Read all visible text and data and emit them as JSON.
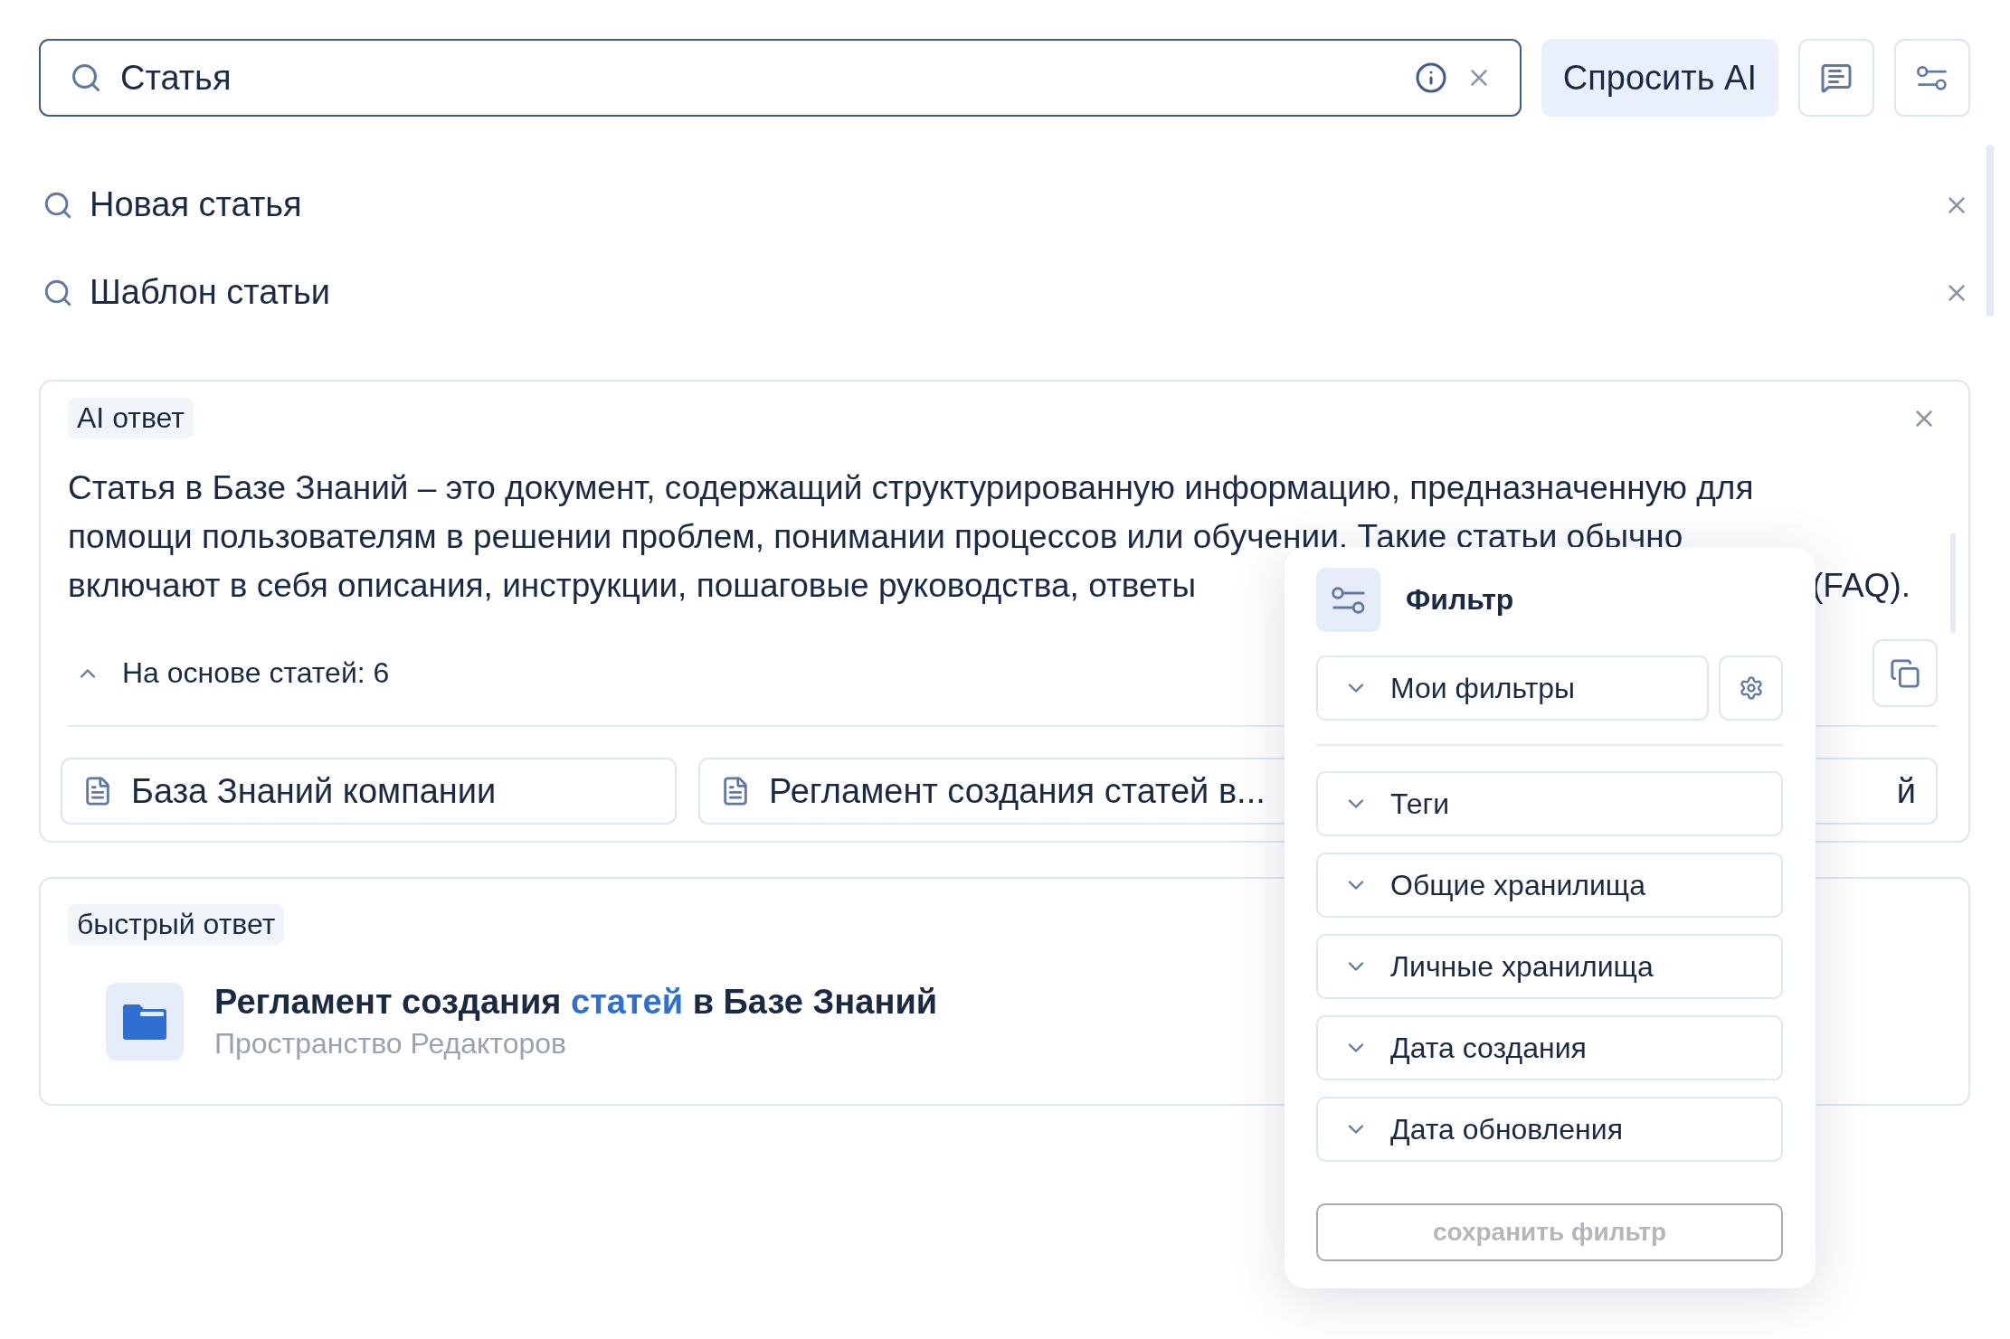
{
  "search": {
    "value": "Статья"
  },
  "ask_button": "Спросить AI",
  "suggestions": [
    {
      "label": "Новая статья"
    },
    {
      "label": "Шаблон статьи"
    }
  ],
  "ai_answer": {
    "tag": "AI ответ",
    "lines": [
      "Статья в Базе Знаний – это документ, содержащий структурированную информацию, предназначенную для",
      "помощи пользователям в решении проблем, понимании процессов или обучении. Такие статьи обычно",
      "включают в себя описания, инструкции, пошаговые руководства, ответы"
    ],
    "line_end": "(FAQ).",
    "sources_toggle": {
      "label": "На основе статей: 6",
      "expanded": true
    },
    "sources": [
      {
        "label": "База Знаний компании"
      },
      {
        "label": "Регламент создания статей в..."
      },
      {
        "label": "й"
      }
    ]
  },
  "quick_answer": {
    "tag": "быстрый ответ",
    "title": [
      {
        "text": "Регламент создания ",
        "highlighted": false
      },
      {
        "text": "статей",
        "highlighted": true
      },
      {
        "text": " в Базе Знаний",
        "highlighted": false
      }
    ],
    "subtitle": "Пространство Редакторов"
  },
  "filter": {
    "title": "Фильтр",
    "saved": {
      "label": "Мои фильтры",
      "expanded": false
    },
    "sections": [
      {
        "label": "Теги",
        "expanded": false
      },
      {
        "label": "Общие хранилища",
        "expanded": false
      },
      {
        "label": "Личные хранилища",
        "expanded": false
      },
      {
        "label": "Дата создания",
        "expanded": false
      },
      {
        "label": "Дата обновления",
        "expanded": false
      }
    ],
    "save_button": {
      "label": "сохранить фильтр",
      "disabled": true
    }
  }
}
